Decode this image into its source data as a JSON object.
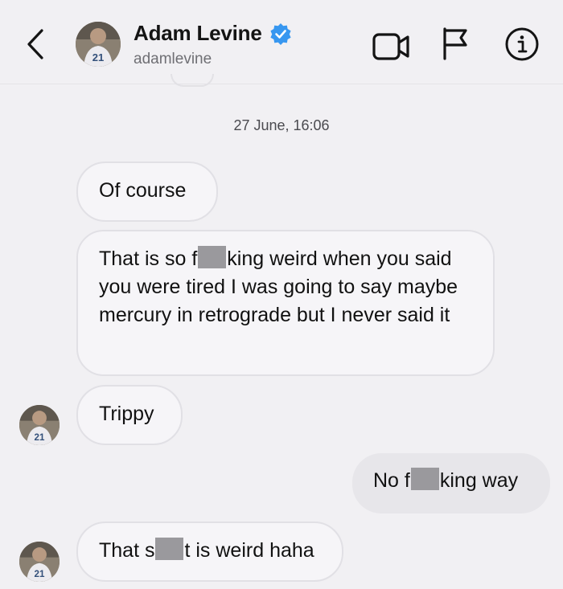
{
  "header": {
    "name": "Adam Levine",
    "username": "adamlevine",
    "verified": true,
    "jersey_number": "21",
    "icons": [
      "back-chevron-icon",
      "verified-badge-icon",
      "video-call-icon",
      "flag-icon",
      "info-icon"
    ]
  },
  "timestamp": "27 June, 16:06",
  "messages": [
    {
      "direction": "incoming",
      "parts": [
        "Of course"
      ]
    },
    {
      "direction": "incoming",
      "parts": [
        "That is so f",
        "king weird when you said you were tired I was going to say maybe mercury in retrograde but I never said it"
      ]
    },
    {
      "direction": "incoming",
      "parts": [
        "Trippy"
      ]
    },
    {
      "direction": "outgoing",
      "parts": [
        "No f",
        "king way"
      ]
    },
    {
      "direction": "incoming",
      "parts": [
        "That s",
        "t is weird haha"
      ]
    }
  ],
  "colors": {
    "background": "#f1f0f3",
    "incoming_bubble": "#f6f5f8",
    "outgoing_bubble": "#e7e6ea",
    "verified_blue": "#3797f0",
    "censor_gray": "#9a999d"
  }
}
